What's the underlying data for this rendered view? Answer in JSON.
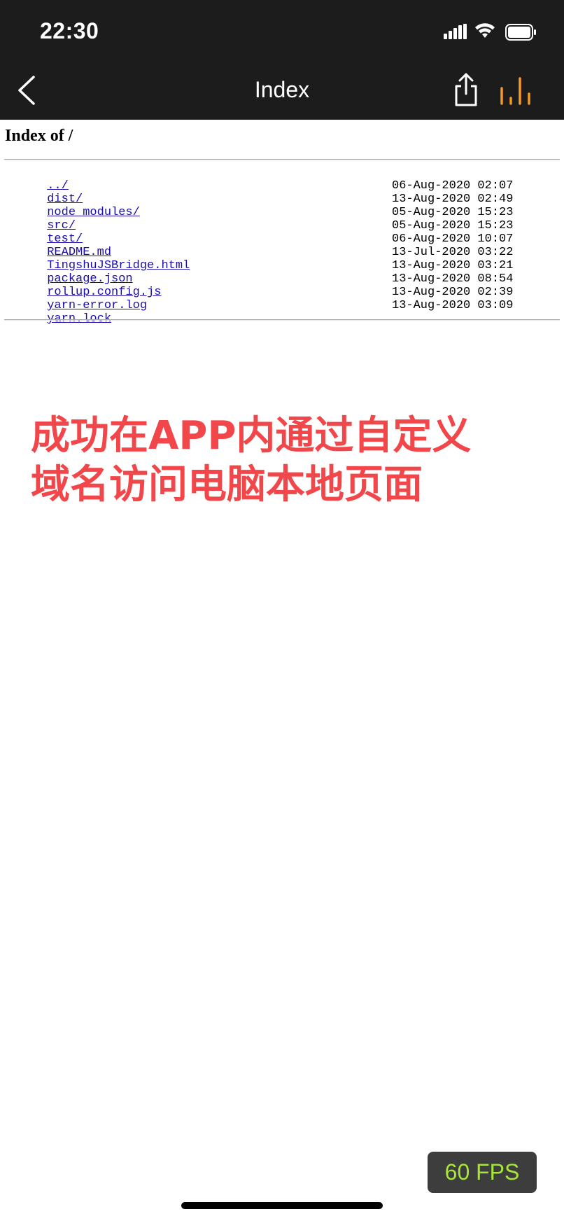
{
  "status_bar": {
    "time": "22:30",
    "icons": [
      "signal-icon",
      "wifi-icon",
      "battery-icon"
    ]
  },
  "nav_bar": {
    "title": "Index",
    "back_icon": "chevron-left-icon",
    "share_icon": "share-icon",
    "stats_icon": "stats-bars-icon",
    "accent_color": "#f59a23"
  },
  "page": {
    "heading": "Index of /",
    "parent_link": "../",
    "entries": [
      {
        "name": "dist/",
        "date": "06-Aug-2020 02:07"
      },
      {
        "name": "node_modules/",
        "date": "13-Aug-2020 02:49"
      },
      {
        "name": "src/",
        "date": "05-Aug-2020 15:23"
      },
      {
        "name": "test/",
        "date": "05-Aug-2020 15:23"
      },
      {
        "name": "README.md",
        "date": "06-Aug-2020 10:07"
      },
      {
        "name": "TingshuJSBridge.html",
        "date": "13-Jul-2020 03:22"
      },
      {
        "name": "package.json",
        "date": "13-Aug-2020 03:21"
      },
      {
        "name": "rollup.config.js",
        "date": "13-Aug-2020 08:54"
      },
      {
        "name": "yarn-error.log",
        "date": "13-Aug-2020 02:39"
      },
      {
        "name": "yarn.lock",
        "date": "13-Aug-2020 03:09"
      }
    ],
    "link_color": "#1a0dab"
  },
  "annotation": {
    "line1": "成功在APP内通过自定义",
    "line2": "域名访问电脑本地页面",
    "color": "#f2474a"
  },
  "fps_badge": {
    "label": "60 FPS",
    "color": "#a7e636"
  }
}
